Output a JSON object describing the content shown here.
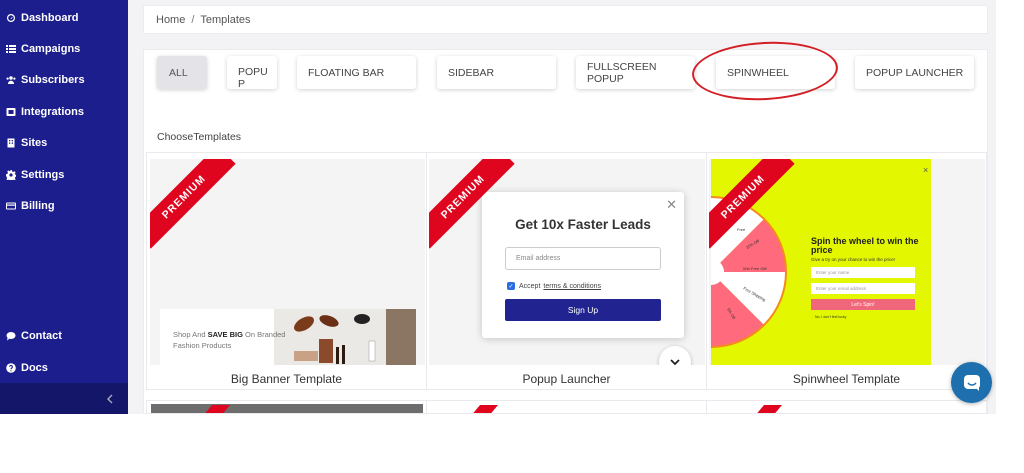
{
  "sidebar": {
    "items": [
      {
        "label": "Dashboard",
        "icon": "dashboard-icon"
      },
      {
        "label": "Campaigns",
        "icon": "list-icon"
      },
      {
        "label": "Subscribers",
        "icon": "users-icon"
      },
      {
        "label": "Integrations",
        "icon": "plug-icon"
      },
      {
        "label": "Sites",
        "icon": "building-icon"
      },
      {
        "label": "Settings",
        "icon": "gear-icon"
      },
      {
        "label": "Billing",
        "icon": "credit-card-icon"
      }
    ],
    "bottom_items": [
      {
        "label": "Contact",
        "icon": "chat-icon"
      },
      {
        "label": "Docs",
        "icon": "question-icon"
      }
    ],
    "collapse_icon": "chevron-left-icon",
    "background": "#1c1e8e"
  },
  "breadcrumb": {
    "home": "Home",
    "separator": "/",
    "current": "Templates"
  },
  "filters": {
    "tabs": [
      "ALL",
      "POPU P",
      "FLOATING BAR",
      "SIDEBAR",
      "FULLSCREEN POPUP",
      "SPINWHEEL",
      "POPUP LAUNCHER"
    ],
    "active": "ALL",
    "highlighted": "SPINWHEEL"
  },
  "section_label": "ChooseTemplates",
  "templates": [
    {
      "title": "Big Banner Template",
      "badge": "PREMIUM",
      "preview": {
        "text_a": "Shop And",
        "text_b": "SAVE BIG",
        "text_c": "On Branded",
        "text_d": "Fashion Products"
      }
    },
    {
      "title": "Popup Launcher",
      "badge": "PREMIUM",
      "preview": {
        "heading": "Get 10x Faster Leads",
        "email_placeholder": "Email address",
        "accept": "Accept",
        "terms": "terms & conditions",
        "button": "Sign Up"
      }
    },
    {
      "title": "Spinwheel Template",
      "badge": "PREMIUM",
      "preview": {
        "close": "×",
        "heading": "Spin the wheel to win the price",
        "sub": "Give a try on your chance to win the price!",
        "name_placeholder": "Enter your name",
        "email_placeholder": "Enter your email address",
        "button": "Let's Spin!",
        "note": "No, I don't feel lucky",
        "wheel_labels": [
          "Free",
          "25% Off",
          "Win Free Gift",
          "Free Shipping",
          "5% Off"
        ]
      }
    }
  ],
  "colors": {
    "accent": "#1c1e8e",
    "ribbon": "#e0051f",
    "highlight": "#d21e24",
    "spin_bg": "#e2f700",
    "chat": "#1d6fad"
  }
}
